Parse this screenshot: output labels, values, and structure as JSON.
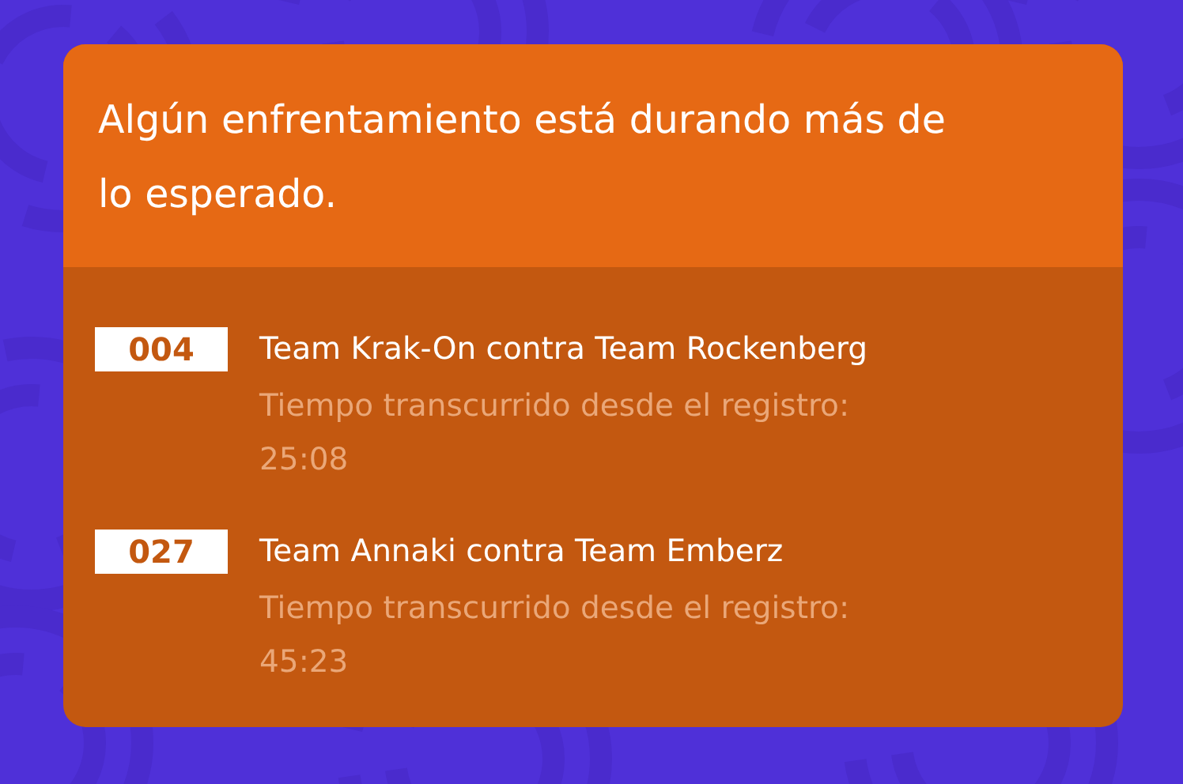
{
  "alert": {
    "title": "Algún enfrentamiento está durando más de lo esperado.",
    "matches": [
      {
        "number": "004",
        "teams": "Team Krak-On contra Team Rockenberg",
        "elapsed_label": "Tiempo transcurrido desde el registro:",
        "elapsed": "25:08"
      },
      {
        "number": "027",
        "teams": "Team Annaki contra Team Emberz",
        "elapsed_label": "Tiempo transcurrido desde el registro:",
        "elapsed": "45:23"
      }
    ]
  }
}
